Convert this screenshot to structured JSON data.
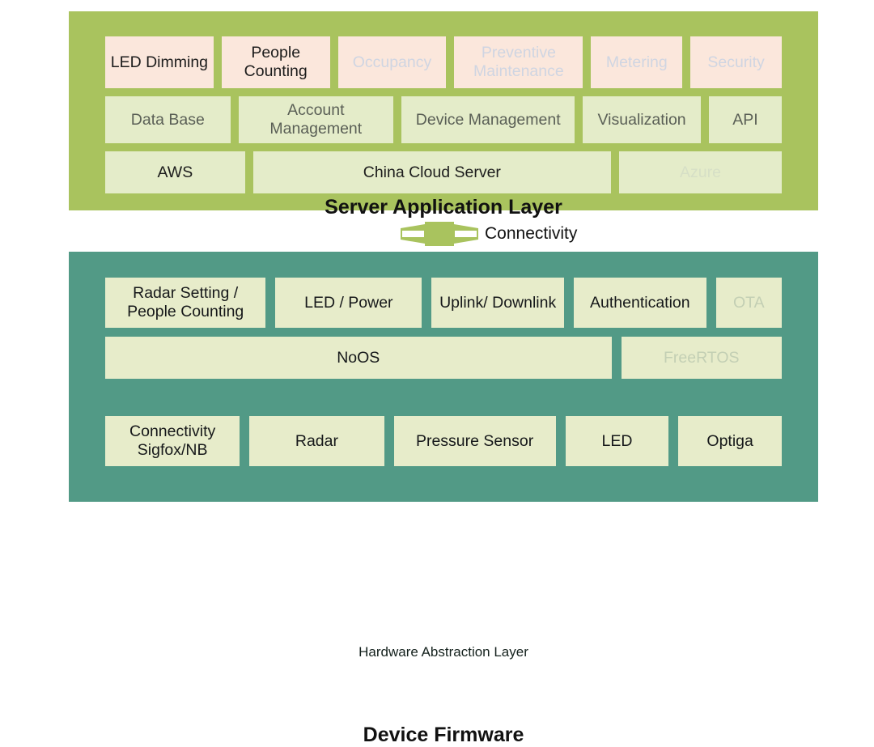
{
  "diagram": {
    "title": "IoT Platform Layered Architecture",
    "colors": {
      "server_layer_bg": "#a9c35e",
      "device_layer_bg": "#529a86",
      "application_box_bg": "#fbe7dc",
      "service_box_bg": "#e4ecc9",
      "firmware_box_bg": "#e7ecca",
      "connector_fill": "#a9c35e",
      "active_text": "#1c1c1c",
      "disabled_text_on_green": "#cfd5e2",
      "disabled_text_on_teal": "#c3cfb4"
    }
  },
  "server_layer": {
    "title": "Server Application Layer",
    "applications": [
      {
        "label": "LED Dimming",
        "enabled": true,
        "flex": 1.45
      },
      {
        "label": "People Counting",
        "enabled": true,
        "flex": 1.45
      },
      {
        "label": "Occupancy",
        "enabled": false,
        "flex": 1.45
      },
      {
        "label": "Preventive Maintenance",
        "enabled": false,
        "flex": 1.75
      },
      {
        "label": "Metering",
        "enabled": false,
        "flex": 1.2
      },
      {
        "label": "Security",
        "enabled": false,
        "flex": 1.2
      }
    ],
    "services": [
      {
        "label": "Data Base",
        "enabled": true,
        "flex": 1.55
      },
      {
        "label": "Account Management",
        "enabled": true,
        "flex": 1.95
      },
      {
        "label": "Device Management",
        "enabled": true,
        "flex": 2.2
      },
      {
        "label": "Visualization",
        "enabled": true,
        "flex": 1.45
      },
      {
        "label": "API",
        "enabled": true,
        "flex": 0.85
      }
    ],
    "clouds": [
      {
        "label": "AWS",
        "enabled": true,
        "flex": 1.7
      },
      {
        "label": "China Cloud Server",
        "enabled": true,
        "flex": 4.55
      },
      {
        "label": "Azure",
        "enabled": false,
        "flex": 2.0
      }
    ]
  },
  "connectivity": {
    "label": "Connectivity",
    "shape": "double-arrow-connector"
  },
  "device_layer": {
    "title": "Device Firmware",
    "hal_label": "Hardware Abstraction Layer",
    "firmware_modules": [
      {
        "label": "Radar Setting / People Counting",
        "enabled": true,
        "flex": 2.15
      },
      {
        "label": "LED / Power",
        "enabled": true,
        "flex": 1.95
      },
      {
        "label": "Uplink/ Downlink",
        "enabled": true,
        "flex": 1.75
      },
      {
        "label": "Authentication",
        "enabled": true,
        "flex": 1.75
      },
      {
        "label": "OTA",
        "enabled": false,
        "flex": 0.8
      }
    ],
    "operating_systems": [
      {
        "label": "NoOS",
        "enabled": true,
        "flex": 5.1
      },
      {
        "label": "FreeRTOS",
        "enabled": false,
        "flex": 1.55
      }
    ],
    "hardware": [
      {
        "label": "Connectivity Sigfox/NB",
        "enabled": true,
        "flex": 1.6
      },
      {
        "label": "Radar",
        "enabled": true,
        "flex": 1.6
      },
      {
        "label": "Pressure Sensor",
        "enabled": true,
        "flex": 1.95
      },
      {
        "label": "LED",
        "enabled": true,
        "flex": 1.2
      },
      {
        "label": "Optiga",
        "enabled": true,
        "flex": 1.2
      }
    ]
  }
}
